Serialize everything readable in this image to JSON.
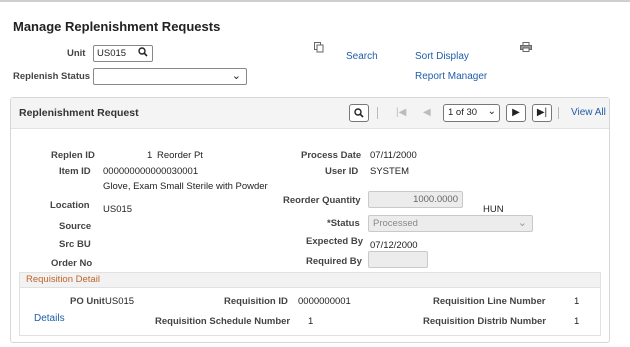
{
  "page": {
    "title": "Manage Replenishment Requests"
  },
  "search": {
    "unit_label": "Unit",
    "unit_value": "US015",
    "replenish_status_label": "Replenish Status",
    "replenish_status_value": ""
  },
  "top_links": {
    "search": "Search",
    "sort_display": "Sort Display",
    "report_manager": "Report Manager"
  },
  "panel": {
    "title": "Replenishment Request",
    "pager_value": "1 of 30",
    "view_all": "View All"
  },
  "fields": {
    "replen_id_label": "Replen ID",
    "replen_id_value": "1",
    "replen_type_value": "Reorder Pt",
    "item_id_label": "Item ID",
    "item_id_value": "000000000000030001",
    "item_desc_value": "Glove, Exam Small Sterile with Powder",
    "location_label": "Location",
    "location_value": "US015",
    "source_label": "Source",
    "src_bu_label": "Src BU",
    "order_no_label": "Order No",
    "process_date_label": "Process Date",
    "process_date_value": "07/11/2000",
    "user_id_label": "User ID",
    "user_id_value": "SYSTEM",
    "reorder_qty_label": "Reorder Quantity",
    "reorder_qty_value": "1000.0000",
    "uom_value": "HUN",
    "status_label": "*Status",
    "status_value": "Processed",
    "expected_by_label": "Expected By",
    "expected_by_value": "07/12/2000",
    "required_by_label": "Required By",
    "required_by_value": ""
  },
  "requisition": {
    "title": "Requisition Detail",
    "po_unit_label": "PO Unit",
    "po_unit_value": "US015",
    "req_id_label": "Requisition ID",
    "req_id_value": "0000000001",
    "req_line_label": "Requisition Line Number",
    "req_line_value": "1",
    "req_sched_label": "Requisition Schedule Number",
    "req_sched_value": "1",
    "req_distrib_label": "Requisition Distrib Number",
    "req_distrib_value": "1",
    "details_link": "Details"
  },
  "icons": {
    "unit_lookup": "search-icon",
    "copy": "copy-icon",
    "print": "printer-icon"
  }
}
